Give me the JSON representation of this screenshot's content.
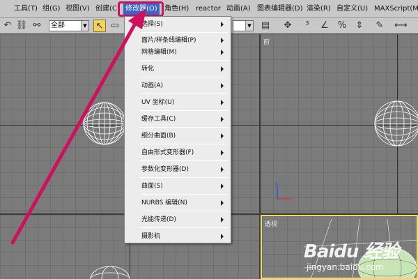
{
  "menubar": {
    "items": [
      {
        "label": "工具(T)"
      },
      {
        "label": "组(G)"
      },
      {
        "label": "视图(V)"
      },
      {
        "label": "创建(C"
      },
      {
        "label": "修改器(O)"
      },
      {
        "label": "角色(H)"
      },
      {
        "label": "reactor"
      },
      {
        "label": "动画(A)"
      },
      {
        "label": "图表编辑器(D)"
      },
      {
        "label": "渲染(R)"
      },
      {
        "label": "自定义(U)"
      },
      {
        "label": "MAXScript(M)"
      }
    ],
    "active": "修改器(O)",
    "active_color": "#3a64c6",
    "highlight_color": "#d0105c"
  },
  "toolbar": {
    "selection_filter": "全部",
    "icons": [
      "undo-icon",
      "link-icon",
      "select-object-icon",
      "select-region-icon",
      "select-by-name-icon",
      "pointer-icon",
      "snap-icon",
      "angle-snap-icon",
      "percent-snap-icon",
      "spinner-snap-icon",
      "named-selection-icon"
    ]
  },
  "viewports": {
    "front_label": "前",
    "perspective_label": "透视",
    "active_border_color": "#e8e05a"
  },
  "dropdown": {
    "items": [
      {
        "label": "选择(S)",
        "submenu": true
      },
      {
        "label": "面片/样条线编辑(P)",
        "submenu": true
      },
      {
        "label": "网格编辑(M)",
        "submenu": true
      },
      {
        "label": "转化",
        "submenu": true
      },
      {
        "label": "动画(A)",
        "submenu": true
      },
      {
        "label": "UV 坐标(U)",
        "submenu": true
      },
      {
        "label": "缓存工具(C)",
        "submenu": true
      },
      {
        "label": "细分曲面(B)",
        "submenu": true
      },
      {
        "label": "自由形式变形器(F)",
        "submenu": true
      },
      {
        "label": "参数化变形器(D)",
        "submenu": true
      },
      {
        "label": "曲面(S)",
        "submenu": true
      },
      {
        "label": "NURBS 编辑(N)",
        "submenu": true
      },
      {
        "label": "光能传递(D)",
        "submenu": true
      },
      {
        "label": "摄影机",
        "submenu": true
      }
    ]
  },
  "annotation": {
    "arrow_color": "#d0105c"
  },
  "watermark": {
    "brand": "Baidu 经验",
    "url": "jingyan.baidu.com"
  }
}
